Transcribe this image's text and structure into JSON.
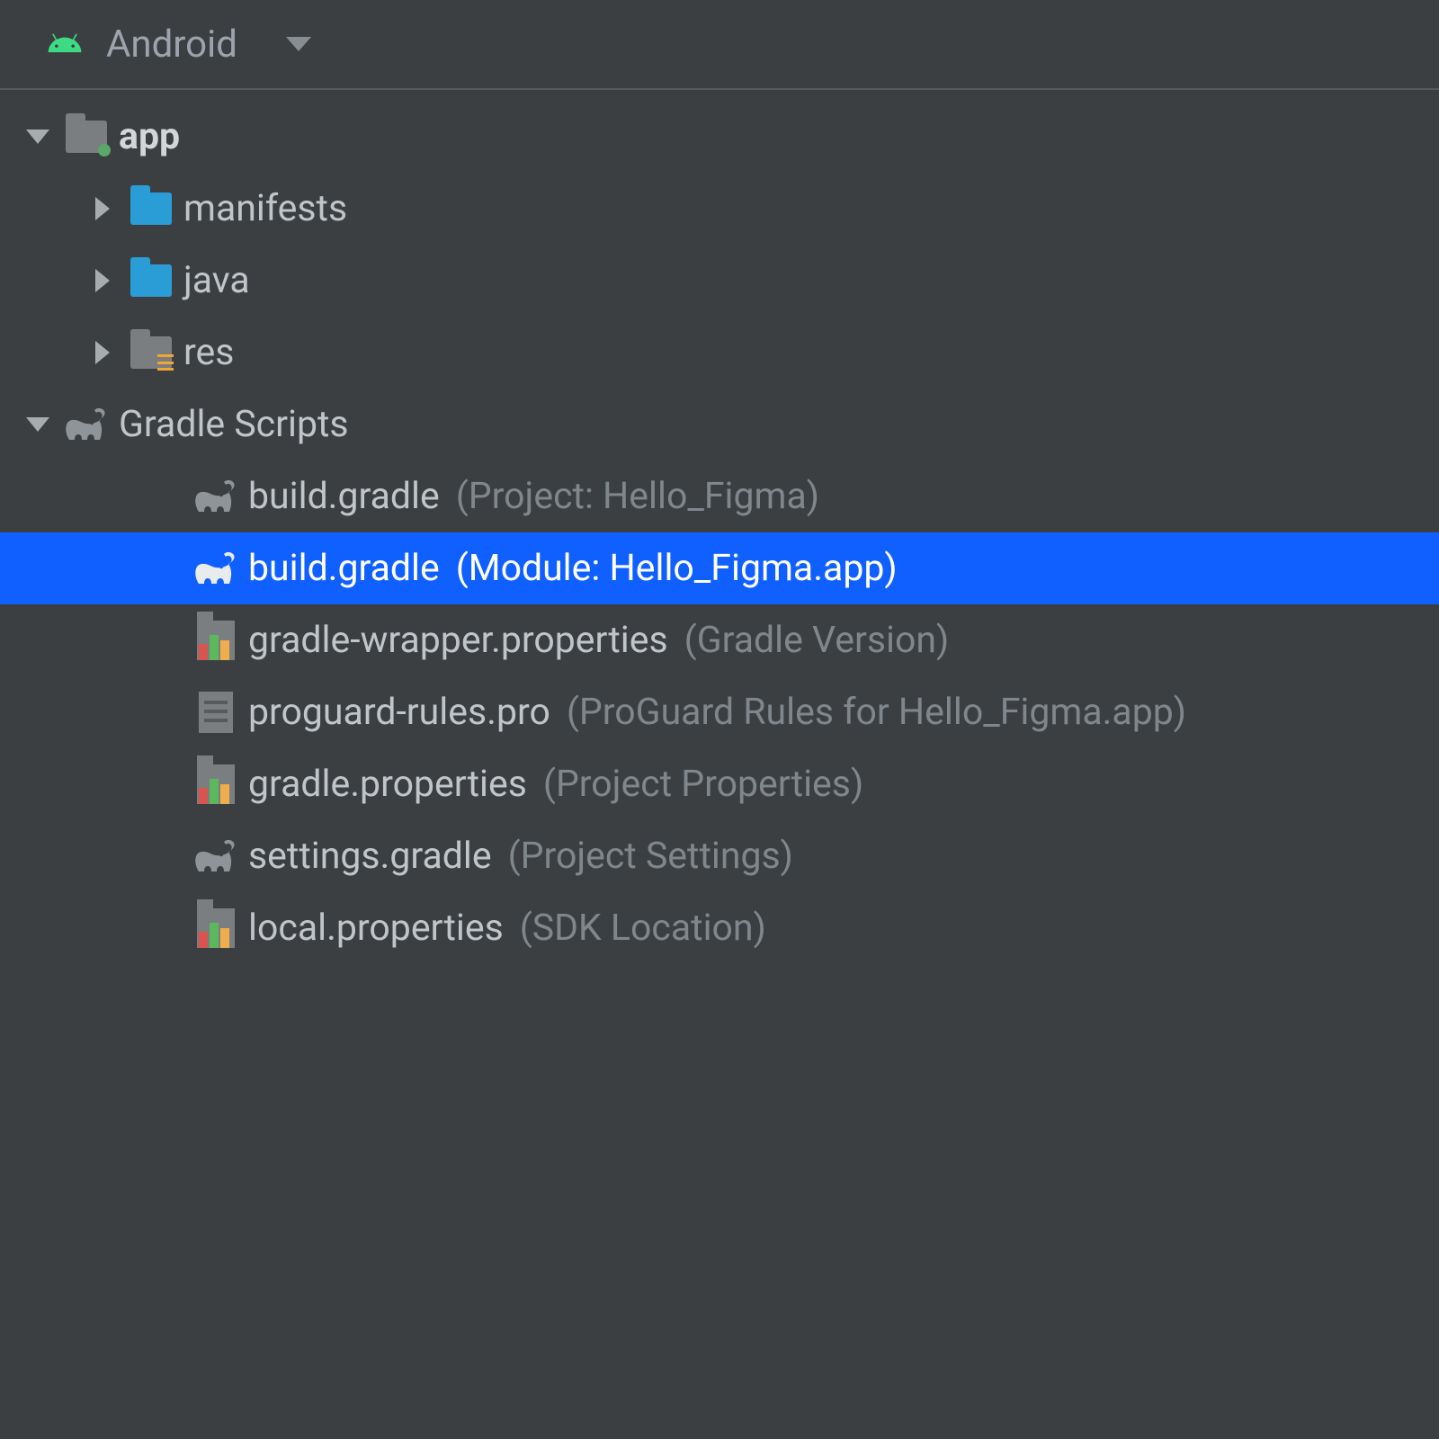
{
  "header": {
    "view_label": "Android"
  },
  "tree": {
    "app": {
      "label": "app",
      "children": {
        "manifests": "manifests",
        "java": "java",
        "res": "res"
      }
    },
    "gradle_scripts": {
      "label": "Gradle Scripts",
      "items": [
        {
          "name": "build.gradle",
          "hint": "(Project: Hello_Figma)",
          "icon": "elephant",
          "selected": false
        },
        {
          "name": "build.gradle",
          "hint": "(Module: Hello_Figma.app)",
          "icon": "elephant",
          "selected": true
        },
        {
          "name": "gradle-wrapper.properties",
          "hint": "(Gradle Version)",
          "icon": "props",
          "selected": false
        },
        {
          "name": "proguard-rules.pro",
          "hint": "(ProGuard Rules for Hello_Figma.app)",
          "icon": "txtfile",
          "selected": false
        },
        {
          "name": "gradle.properties",
          "hint": "(Project Properties)",
          "icon": "props",
          "selected": false
        },
        {
          "name": "settings.gradle",
          "hint": "(Project Settings)",
          "icon": "elephant",
          "selected": false
        },
        {
          "name": "local.properties",
          "hint": "(SDK Location)",
          "icon": "props",
          "selected": false
        }
      ]
    }
  }
}
